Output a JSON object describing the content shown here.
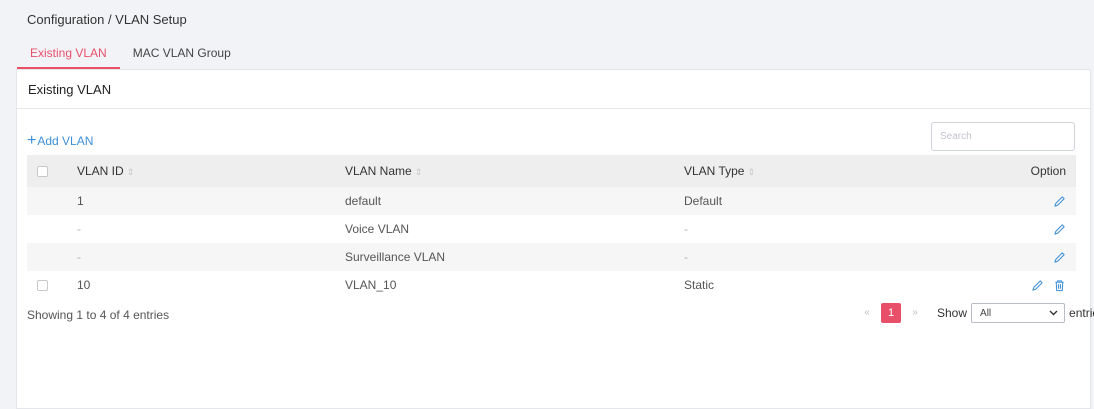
{
  "breadcrumb": "Configuration / VLAN Setup",
  "tabs": [
    {
      "label": "Existing VLAN",
      "active": true
    },
    {
      "label": "MAC VLAN Group",
      "active": false
    }
  ],
  "panel_title": "Existing VLAN",
  "add_button": "Add VLAN",
  "search_placeholder": "Search",
  "table": {
    "headers": {
      "id": "VLAN ID",
      "name": "VLAN Name",
      "type": "VLAN Type",
      "option": "Option"
    },
    "rows": [
      {
        "id": "1",
        "name": "default",
        "type": "Default",
        "checkbox": false,
        "deletable": false
      },
      {
        "id": "-",
        "name": "Voice VLAN",
        "type": "-",
        "checkbox": false,
        "deletable": false
      },
      {
        "id": "-",
        "name": "Surveillance VLAN",
        "type": "-",
        "checkbox": false,
        "deletable": false
      },
      {
        "id": "10",
        "name": "VLAN_10",
        "type": "Static",
        "checkbox": true,
        "deletable": true
      }
    ]
  },
  "footer": {
    "info": "Showing 1 to 4 of 4 entries",
    "prev": "«",
    "page": "1",
    "next": "»",
    "show_label": "Show",
    "page_size": "All",
    "entries_label": "entries"
  },
  "colors": {
    "accent": "#e8506a",
    "link": "#3d8fd6"
  }
}
